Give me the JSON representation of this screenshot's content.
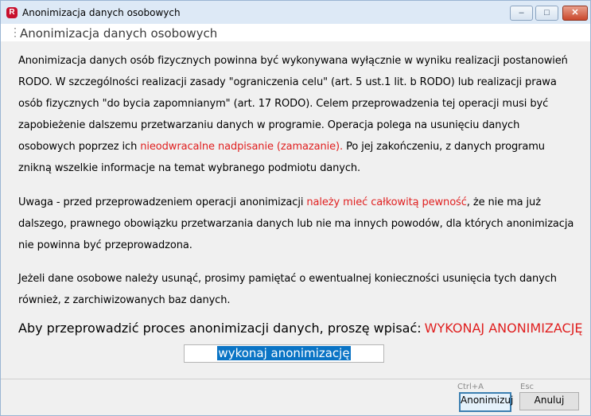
{
  "window": {
    "title": "Anonimizacja danych osobowych",
    "app_icon_letter": "R",
    "controls": {
      "minimize": "–",
      "maximize": "□",
      "close": "✕"
    }
  },
  "header": {
    "title": "Anonimizacja danych osobowych"
  },
  "body": {
    "p1_a": "Anonimizacja danych osób fizycznych powinna być wykonywana wyłącznie w wyniku realizacji postanowień RODO. W szczególności realizacji zasady \"ograniczenia celu\" (art. 5 ust.1 lit. b RODO) lub realizacji prawa osób fizycznych \"do bycia zapomnianym\" (art. 17 RODO). Celem przeprowadzenia tej operacji musi być zapobieżenie dalszemu przetwarzaniu danych w programie. Operacja polega na usunięciu danych osobowych poprzez ich ",
    "p1_red": "nieodwracalne nadpisanie (zamazanie).",
    "p1_b": "  Po jej zakończeniu, z danych programu znikną wszelkie informacje na temat wybranego podmiotu danych.",
    "p2_a": "Uwaga - przed przeprowadzeniem operacji anonimizacji ",
    "p2_red": "należy mieć całkowitą pewność",
    "p2_b": ", że nie ma już dalszego, prawnego obowiązku przetwarzania danych lub nie ma innych powodów, dla których anonimizacja nie powinna być przeprowadzona.",
    "p3": "Jeżeli dane osobowe należy usunąć, prosimy pamiętać o ewentualnej konieczności usunięcia tych danych również, z zarchiwizowanych baz danych."
  },
  "prompt": {
    "label": "Aby przeprowadzić proces anonimizacji danych, proszę wpisać:",
    "keyword": "WYKONAJ ANONIMIZACJĘ"
  },
  "input": {
    "value": "wykonaj anonimizację"
  },
  "buttons": {
    "confirm_label": "Anonimizuj",
    "confirm_shortcut": "Ctrl+A",
    "cancel_label": "Anuluj",
    "cancel_shortcut": "Esc"
  },
  "colors": {
    "accent_red": "#e02020",
    "selection_blue": "#0a74c5"
  }
}
